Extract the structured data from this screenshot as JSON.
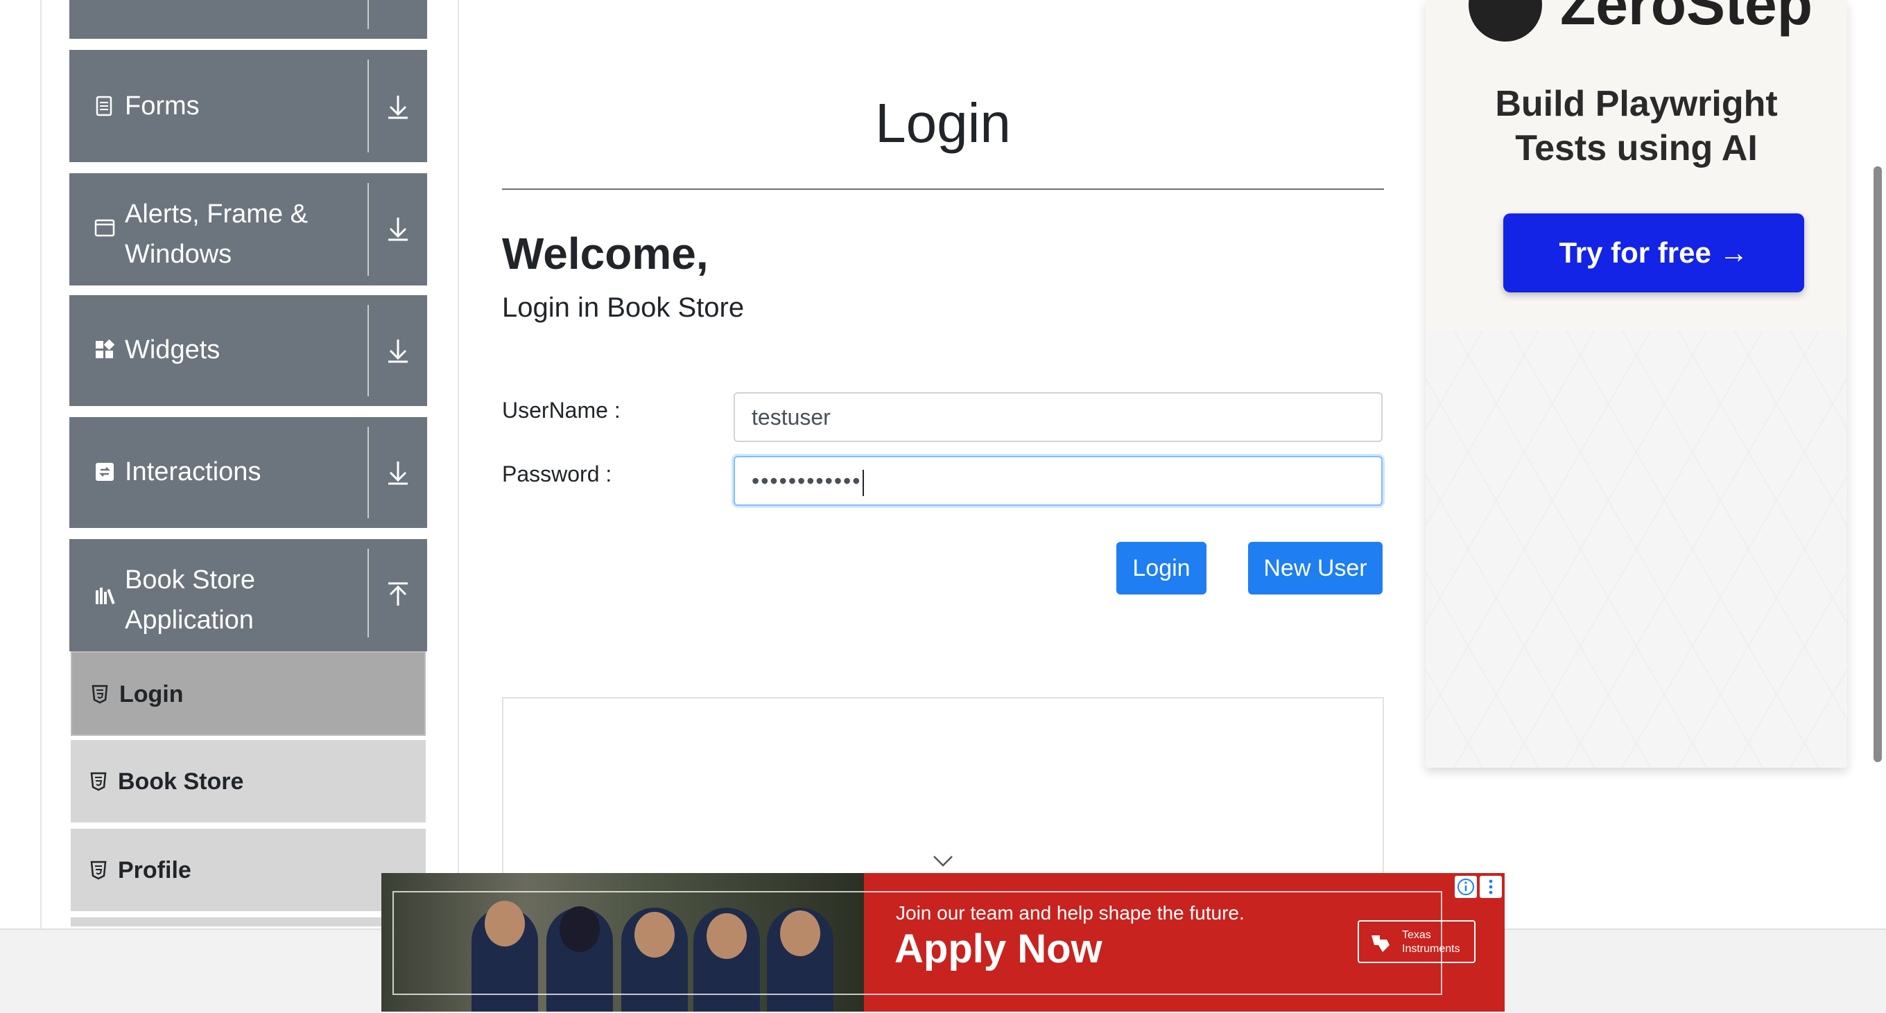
{
  "sidebar": {
    "groups": [
      {
        "label": "",
        "icon": "document-icon"
      },
      {
        "label": "Forms",
        "icon": "document-icon"
      },
      {
        "label_line1": "Alerts, Frame &",
        "label_line2": "Windows",
        "icon": "window-icon"
      },
      {
        "label": "Widgets",
        "icon": "widgets-icon"
      },
      {
        "label": "Interactions",
        "icon": "interactions-icon"
      },
      {
        "label_line1": "Book Store",
        "label_line2": "Application",
        "icon": "books-icon"
      }
    ],
    "book_store_items": [
      {
        "label": "Login",
        "active": true
      },
      {
        "label": "Book Store",
        "active": false
      },
      {
        "label": "Profile",
        "active": false
      }
    ]
  },
  "main": {
    "page_title": "Login",
    "welcome": "Welcome,",
    "subheading": "Login in Book Store",
    "username_label": "UserName :",
    "username_value": "testuser",
    "password_label": "Password :",
    "password_mask": "••••••••••••",
    "login_button": "Login",
    "new_user_button": "New User"
  },
  "ad_right": {
    "brand": "ZeroStep",
    "headline_line1": "Build Playwright",
    "headline_line2": "Tests using AI",
    "cta": "Try for free →"
  },
  "banner_ad": {
    "tagline": "Join our team and help shape the future.",
    "headline": "Apply Now",
    "logo_line1": "Texas",
    "logo_line2": "Instruments"
  },
  "colors": {
    "sidebar_group_bg": "#6c757d",
    "sub_item_bg": "#d6d6d6",
    "sub_item_active_bg": "#a9a9a9",
    "primary_button": "#1e7ef2",
    "ad_cta": "#1324e6",
    "banner_bg": "#c8231f"
  }
}
